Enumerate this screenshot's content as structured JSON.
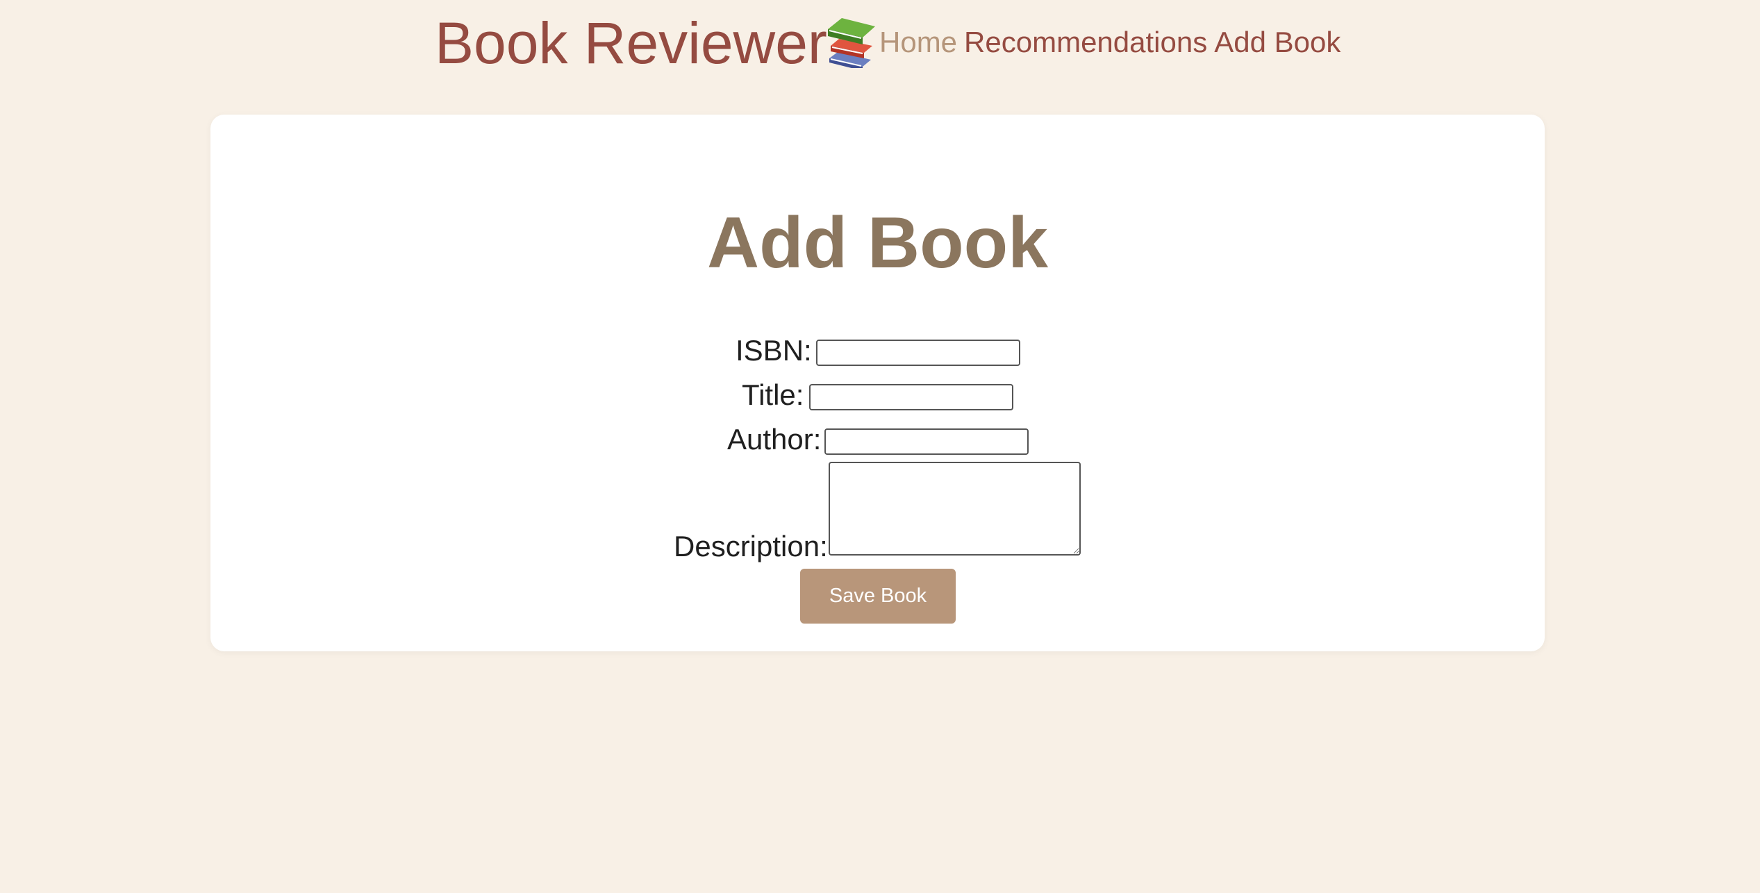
{
  "header": {
    "site_title": "Book Reviewer",
    "logo_icon": "books-stack-icon",
    "nav": [
      {
        "label": "Home",
        "active": true
      },
      {
        "label": "Recommendations",
        "active": false
      },
      {
        "label": "Add Book",
        "active": false
      }
    ]
  },
  "main": {
    "title": "Add Book",
    "form": {
      "isbn_label": "ISBN:",
      "isbn_value": "",
      "title_label": "Title:",
      "title_value": "",
      "author_label": "Author:",
      "author_value": "",
      "description_label": "Description:",
      "description_value": "",
      "save_label": "Save Book"
    }
  },
  "colors": {
    "background": "#f8f0e6",
    "brand": "#954b41",
    "nav_active": "#b5957a",
    "heading": "#8b765e",
    "button": "#b8967a"
  }
}
